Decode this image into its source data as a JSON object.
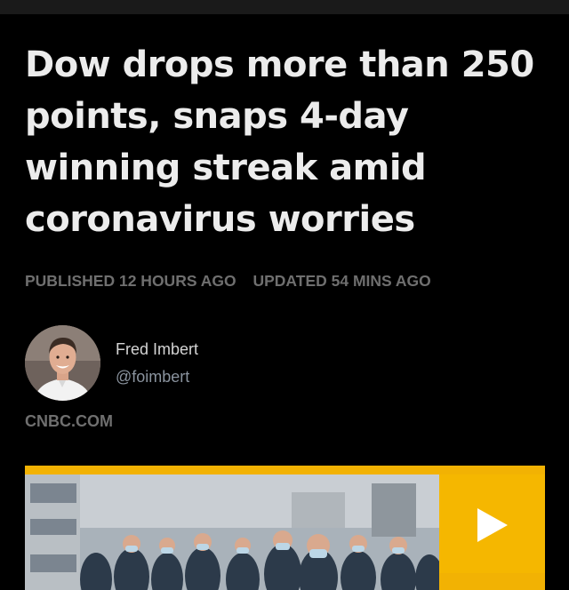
{
  "article": {
    "headline": "Dow drops more than 250 points, snaps 4-day winning streak amid coronavirus worries",
    "published": "PUBLISHED 12 HOURS AGO",
    "updated": "UPDATED 54 MINS AGO",
    "source": "CNBC.COM"
  },
  "author": {
    "name": "Fred Imbert",
    "handle": "@foimbert"
  },
  "video": {
    "play_icon": "play-icon",
    "accent_color": "#f5b700"
  },
  "colors": {
    "background": "#000000",
    "headline": "#ececec",
    "meta": "#6f6f6f"
  }
}
